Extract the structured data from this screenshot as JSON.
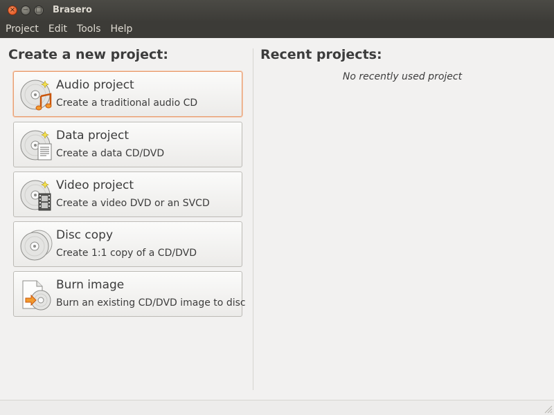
{
  "window": {
    "title": "Brasero",
    "close_glyph": "×",
    "minimize_glyph": "−",
    "maximize_glyph": "□"
  },
  "menu": [
    "Project",
    "Edit",
    "Tools",
    "Help"
  ],
  "new_project": {
    "heading": "Create a new project:",
    "buttons": [
      {
        "title": "Audio project",
        "description": "Create a traditional audio CD",
        "icon": "audio-disc-icon"
      },
      {
        "title": "Data project",
        "description": "Create a data CD/DVD",
        "icon": "data-disc-icon"
      },
      {
        "title": "Video project",
        "description": "Create a video DVD or an SVCD",
        "icon": "video-disc-icon"
      },
      {
        "title": "Disc copy",
        "description": "Create 1:1 copy of a CD/DVD",
        "icon": "disc-copy-icon"
      },
      {
        "title": "Burn image",
        "description": "Burn an existing CD/DVD image to disc",
        "icon": "burn-image-icon"
      }
    ]
  },
  "recent": {
    "heading": "Recent projects:",
    "empty_message": "No recently used project"
  },
  "colors": {
    "titlebar": "#3c3b37",
    "focus_border": "#e89e72",
    "close_button": "#df4a16"
  }
}
